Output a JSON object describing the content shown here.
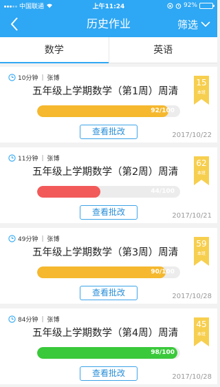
{
  "status_bar": {
    "carrier": "中国联通",
    "time": "上午11:24",
    "battery": "92%",
    "battery_level": 0.92
  },
  "nav": {
    "title": "历史作业",
    "filter_label": "筛选"
  },
  "tabs": [
    {
      "label": "数学",
      "active": true
    },
    {
      "label": "英语",
      "active": false
    }
  ],
  "review_label": "查看批改",
  "rank_label": "本班",
  "cards": [
    {
      "duration": "10分钟",
      "teacher": "张博",
      "title": "五年级上学期数学（第1周）周清",
      "score_text": "92/100",
      "score": 0.92,
      "color": "#f5b82e",
      "date": "2017/10/22",
      "rank": "15"
    },
    {
      "duration": "11分钟",
      "teacher": "张博",
      "title": "五年级上学期数学（第2周）周清",
      "score_text": "44/100",
      "score": 0.44,
      "color": "#f25a5a",
      "date": "2017/10/21",
      "rank": "62"
    },
    {
      "duration": "49分钟",
      "teacher": "张博",
      "title": "五年级上学期数学（第3周）周清",
      "score_text": "90/100",
      "score": 0.9,
      "color": "#f5b82e",
      "date": "2017/10/28",
      "rank": "59"
    },
    {
      "duration": "84分钟",
      "teacher": "张博",
      "title": "五年级上学期数学（第4周）周清",
      "score_text": "98/100",
      "score": 0.98,
      "color": "#3ac93a",
      "date": "2017/10/28",
      "rank": "45"
    }
  ],
  "colors": {
    "primary": "#2ea7f4",
    "ribbon": "#f7cf4f",
    "button_border": "#3ba3e8"
  }
}
